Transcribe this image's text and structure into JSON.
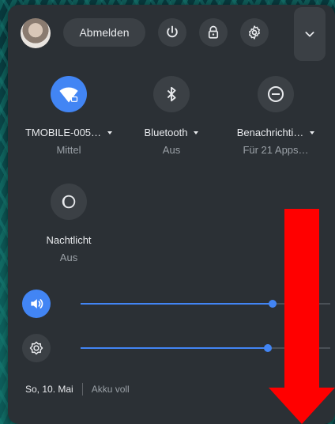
{
  "header": {
    "signout_label": "Abmelden"
  },
  "tiles": [
    {
      "label": "TMOBILE-005…",
      "sub": "Mittel"
    },
    {
      "label": "Bluetooth",
      "sub": "Aus"
    },
    {
      "label": "Benachrichti…",
      "sub": "Für 21 Apps…"
    },
    {
      "label": "Nachtlicht",
      "sub": "Aus"
    }
  ],
  "sliders": {
    "volume": {
      "level_percent": 77
    },
    "brightness": {
      "level_percent": 75
    }
  },
  "status": {
    "date": "So, 10. Mai",
    "battery": "Akku voll"
  },
  "icons": {
    "avatar": "avatar",
    "power": "power-icon",
    "lock": "lock-icon",
    "settings": "gear-icon",
    "collapse": "chevron-down-icon",
    "wifi": "wifi-icon",
    "bluetooth": "bluetooth-icon",
    "dnd": "do-not-disturb-icon",
    "night_light": "moon-icon",
    "volume": "speaker-icon",
    "brightness": "brightness-icon"
  },
  "colors": {
    "accent": "#4285f4",
    "panel": "#2b3035",
    "annotation_arrow": "#ff0000"
  }
}
